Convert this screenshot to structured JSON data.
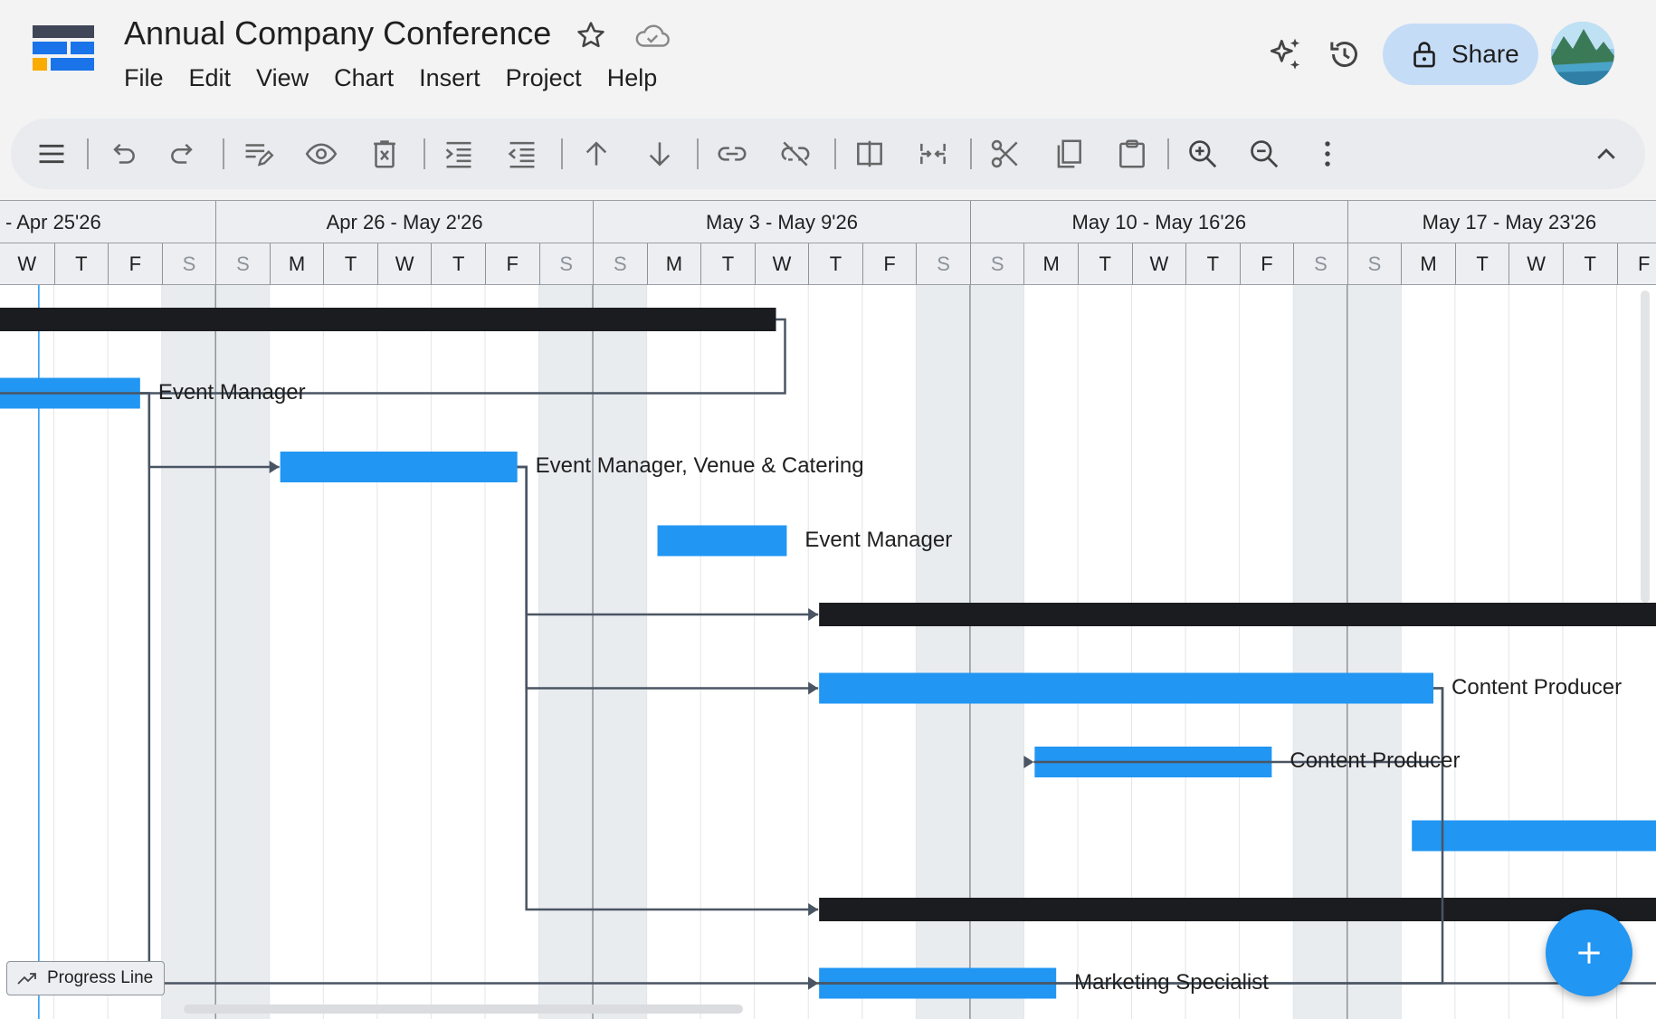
{
  "header": {
    "title": "Annual Company Conference",
    "menu": [
      "File",
      "Edit",
      "View",
      "Chart",
      "Insert",
      "Project",
      "Help"
    ],
    "share_label": "Share"
  },
  "toolbar": {
    "items": [
      "menu-icon",
      "undo-icon",
      "redo-icon",
      "edit-task-icon",
      "view-icon",
      "delete-icon",
      "indent-icon",
      "outdent-icon",
      "move-up-icon",
      "move-down-icon",
      "link-icon",
      "unlink-icon",
      "split-icon",
      "merge-icon",
      "cut-icon",
      "copy-icon",
      "paste-icon",
      "zoom-in-icon",
      "zoom-out-icon",
      "more-icon",
      "collapse-icon"
    ]
  },
  "timescale": {
    "weeks": [
      "- Apr 25'26",
      "Apr 26 - May 2'26",
      "May 3 - May 9'26",
      "May 10 - May 16'26",
      "May 17 - May 23'26"
    ],
    "days": [
      "W",
      "T",
      "F",
      "S",
      "S",
      "M",
      "T",
      "W",
      "T",
      "F",
      "S",
      "S",
      "M",
      "T",
      "W",
      "T",
      "F",
      "S",
      "S",
      "M",
      "T",
      "W",
      "T",
      "F",
      "S",
      "S",
      "M",
      "T",
      "W",
      "T",
      "F"
    ]
  },
  "gantt": {
    "start_day_index": 0,
    "today_day_offset": 0.72,
    "tasks": [
      {
        "row": 0,
        "type": "summary",
        "start": -0.03,
        "end": 14.4,
        "label": ""
      },
      {
        "row": 1,
        "type": "task",
        "start": -0.03,
        "end": 2.6,
        "label": "Event Manager"
      },
      {
        "row": 2,
        "type": "task",
        "start": 5.2,
        "end": 9.6,
        "label": "Event Manager, Venue & Catering"
      },
      {
        "row": 3,
        "type": "task",
        "start": 12.2,
        "end": 14.6,
        "label": "Event Manager"
      },
      {
        "row": 4,
        "type": "summary",
        "start": 15.2,
        "end": 31.0,
        "label": ""
      },
      {
        "row": 5,
        "type": "task",
        "start": 15.2,
        "end": 26.6,
        "label": "Content Producer"
      },
      {
        "row": 6,
        "type": "task",
        "start": 19.2,
        "end": 23.6,
        "label": "Content Producer"
      },
      {
        "row": 7,
        "type": "task",
        "start": 26.2,
        "end": 31.0,
        "label": ""
      },
      {
        "row": 8,
        "type": "summary",
        "start": 15.2,
        "end": 31.0,
        "label": ""
      },
      {
        "row": 9,
        "type": "task",
        "start": 15.2,
        "end": 19.6,
        "label": "Marketing Specialist"
      }
    ],
    "dependencies": [
      {
        "from": 1,
        "to": 2
      },
      {
        "from": 2,
        "to": 3
      },
      {
        "from": 3,
        "to": 5
      },
      {
        "from": 3,
        "to": 6
      },
      {
        "from": 6,
        "to": 7
      },
      {
        "from": 3,
        "to": 9
      },
      {
        "from": 2,
        "to": 10
      },
      {
        "from": 9,
        "to": 10
      },
      {
        "from": 6,
        "to": 10
      }
    ],
    "progress_line_label": "Progress Line"
  },
  "colors": {
    "bar": "#2196f3",
    "summary": "#1b1c1f",
    "weekend": "#e9ecef",
    "today": "#2196f3",
    "link": "#4a5563"
  }
}
